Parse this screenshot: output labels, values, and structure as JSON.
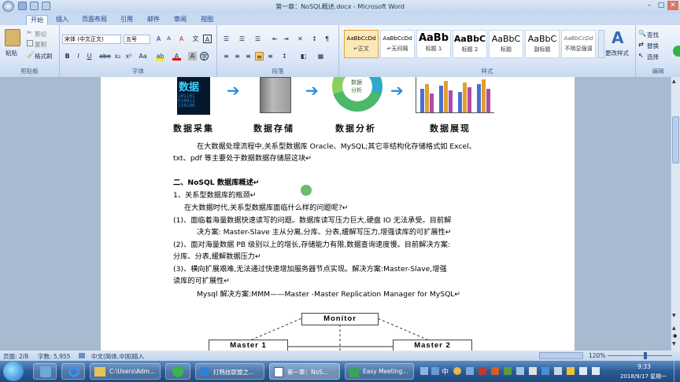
{
  "window": {
    "title": "第一章：NoSQL概述.docx - Microsoft Word"
  },
  "tabs": [
    "开始",
    "插入",
    "页面布局",
    "引用",
    "邮件",
    "审阅",
    "视图"
  ],
  "ribbon": {
    "clipboard": {
      "paste": "粘贴",
      "cut": "剪切",
      "copy": "复制",
      "format_painter": "格式刷",
      "label": "剪贴板"
    },
    "font": {
      "name": "宋体 (中文正文)",
      "size": "五号",
      "label": "字体"
    },
    "paragraph": {
      "label": "段落"
    },
    "styles": {
      "items": [
        {
          "preview": "AaBbCcDd",
          "name": "↵正文"
        },
        {
          "preview": "AaBbCcDd",
          "name": "↵无间隔"
        },
        {
          "preview": "AaBb",
          "name": "标题 1"
        },
        {
          "preview": "AaBbC",
          "name": "标题 2"
        },
        {
          "preview": "AaBbC",
          "name": "标题"
        },
        {
          "preview": "AaBbC",
          "name": "副标题"
        },
        {
          "preview": "AaBbCcDd",
          "name": "不明显强调"
        }
      ],
      "change": "更改样式",
      "label": "样式"
    },
    "editing": {
      "find": "查找",
      "replace": "替换",
      "select": "选择",
      "label": "编辑"
    }
  },
  "document": {
    "caption1": "数据采集",
    "caption2": "数据存储",
    "caption3": "数据分析",
    "caption4": "数据展现",
    "pie_text1": "数据",
    "pie_text2": "分析",
    "para1_a": "在大数据处理流程中,关系型数据库 Oracle、MySQL;其它非结构化存储格式如 Excel、",
    "para1_b": "txt、pdf 等主要处于数据数据存储层这块↵",
    "heading2": "二、NoSQL 数据库概述↵",
    "item1": "1、关系型数据库的瓶颈↵",
    "question": "在大数据时代,关系型数据库面临什么样的问题呢?↵",
    "p1_a": "(1)、面临着海量数据快速读写的问题。数据库读写压力巨大,硬盘 IO 无法承受。目前解",
    "p1_b": "决方案: Master-Slave 主从分离,分库、分表,缓解写压力,增强读库的可扩展性↵",
    "p2_a": "(2)、面对海量数据 PB 级别以上的增长,存储能力有限,数据查询速度慢。目前解决方案:",
    "p2_b": "分库、分表,缓解数据压力↵",
    "p3_a": "(3)、横向扩展艰难,无法通过快速增加服务器节点实现。解决方案:Master-Slave,增强",
    "p3_b": "读库的可扩展性↵",
    "mysql": "Mysql 解决方案:MMM——Master -Master Replication Manager for MySQL↵",
    "diagram": {
      "monitor": "Monitor",
      "master1": "Master 1",
      "master2": "Master 2"
    }
  },
  "status": {
    "page": "页面: 2/8",
    "words": "字数: 5,955",
    "language": "中文(简体,中国)",
    "mode": "插入",
    "zoom": "120%"
  },
  "taskbar": {
    "items": [
      "C:\\Users\\Adm...",
      "打韩技联盟之...",
      "第一章：NoS...",
      "Easy Meeting..."
    ],
    "time": "9:33",
    "date": "2018/9/17 星期一",
    "ime": "中"
  }
}
